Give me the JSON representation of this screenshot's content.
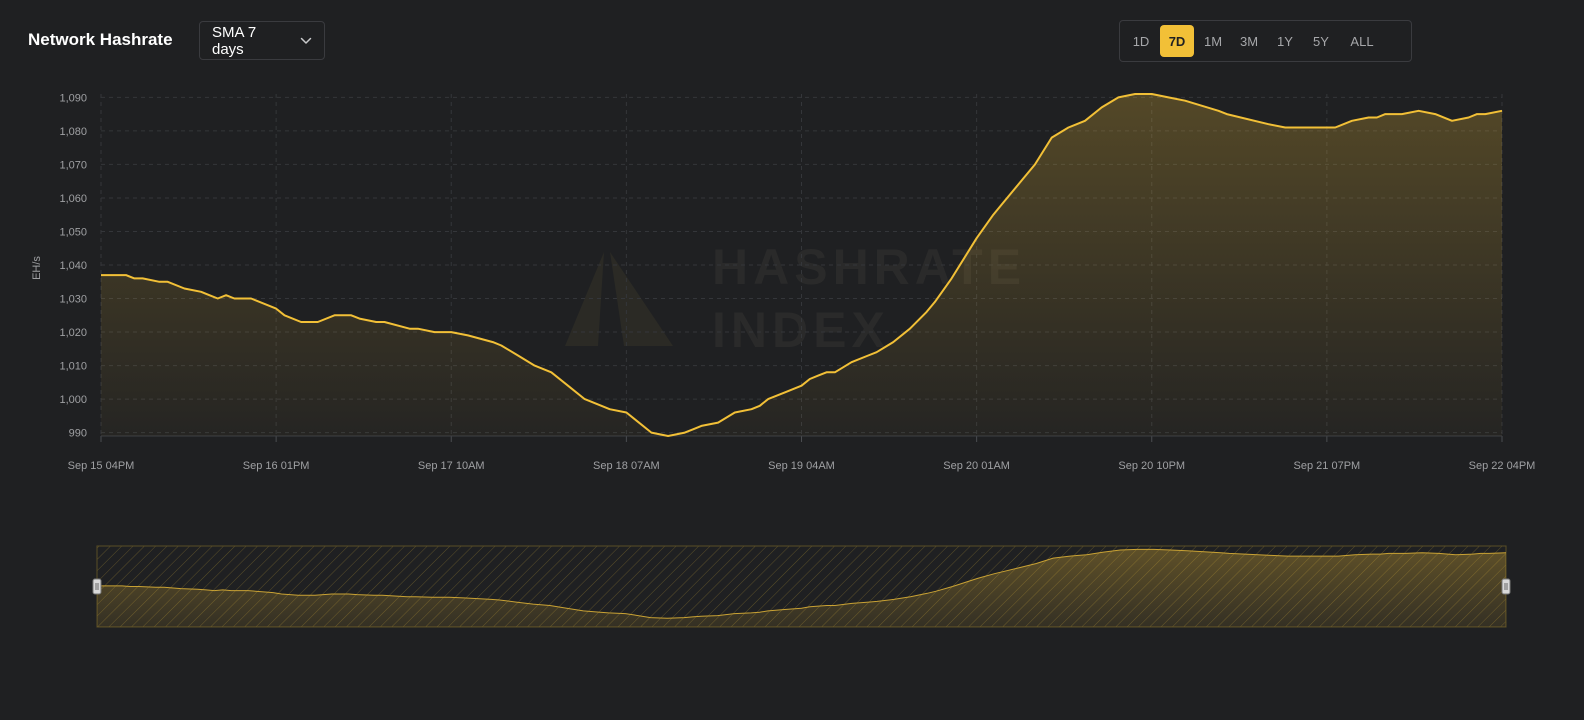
{
  "header": {
    "title": "Network Hashrate",
    "sma_label": "SMA 7 days",
    "ranges": [
      "1D",
      "7D",
      "1M",
      "3M",
      "1Y",
      "5Y",
      "ALL"
    ],
    "active_range": "7D"
  },
  "watermark": {
    "line1": "HASHRATE",
    "line2": "INDEX"
  },
  "colors": {
    "accent": "#f2c037",
    "background": "#1f2022",
    "grid": "#34363a",
    "tick_text": "#9fa0a3"
  },
  "chart_data": {
    "type": "area",
    "title": "",
    "xlabel": "",
    "ylabel": "EH/s",
    "ylim": [
      989,
      1091
    ],
    "yticks": [
      990,
      1000,
      1010,
      1020,
      1030,
      1040,
      1050,
      1060,
      1070,
      1080,
      1090
    ],
    "ytick_labels": [
      "990",
      "1,000",
      "1,010",
      "1,020",
      "1,030",
      "1,040",
      "1,050",
      "1,060",
      "1,070",
      "1,080",
      "1,090"
    ],
    "xlim": [
      0,
      168
    ],
    "xticks": [
      0,
      21,
      42,
      63,
      84,
      105,
      126,
      147,
      168
    ],
    "xtick_labels": [
      "Sep 15 04PM",
      "Sep 16 01PM",
      "Sep 17 10AM",
      "Sep 18 07AM",
      "Sep 19 04AM",
      "Sep 20 01AM",
      "Sep 20 10PM",
      "Sep 21 07PM",
      "Sep 22 04PM"
    ],
    "grid": true,
    "series": [
      {
        "x": [
          0,
          2,
          3,
          4,
          5,
          7,
          8,
          10,
          12,
          13,
          14,
          15,
          16,
          17,
          18,
          21,
          22,
          24,
          26,
          28,
          30,
          31,
          33,
          34,
          37,
          38,
          40,
          42,
          44,
          47,
          48,
          50,
          52,
          54,
          56,
          58,
          60,
          61,
          63,
          64,
          66,
          68,
          70,
          71,
          72,
          74,
          76,
          78,
          79,
          80,
          82,
          84,
          85,
          86,
          87,
          88,
          90,
          92,
          93,
          95,
          97,
          99,
          100,
          102,
          105,
          107,
          108,
          110,
          112,
          114,
          116,
          117,
          118,
          120,
          122,
          124,
          125,
          126,
          128,
          130,
          134,
          135,
          140,
          142,
          144,
          146,
          148,
          150,
          152,
          153,
          154,
          156,
          158,
          160,
          162,
          164,
          165,
          166,
          168
        ],
        "y": [
          1037,
          1037,
          1037,
          1036,
          1036,
          1035,
          1035,
          1033,
          1032,
          1031,
          1030,
          1031,
          1030,
          1030,
          1030,
          1027,
          1025,
          1023,
          1023,
          1025,
          1025,
          1024,
          1023,
          1023,
          1021,
          1021,
          1020,
          1020,
          1019,
          1017,
          1016,
          1013,
          1010,
          1008,
          1004,
          1000,
          998,
          997,
          996,
          994,
          990,
          989,
          990,
          991,
          992,
          993,
          996,
          997,
          998,
          1000,
          1002,
          1004,
          1006,
          1007,
          1008,
          1008,
          1011,
          1013,
          1014,
          1017,
          1021,
          1026,
          1029,
          1036,
          1048,
          1055,
          1058,
          1064,
          1070,
          1078,
          1081,
          1082,
          1083,
          1087,
          1090,
          1091,
          1091,
          1091,
          1090,
          1089,
          1086,
          1085,
          1082,
          1081,
          1081,
          1081,
          1081,
          1083,
          1084,
          1084,
          1085,
          1085,
          1086,
          1085,
          1083,
          1084,
          1085,
          1085,
          1086
        ]
      }
    ]
  }
}
